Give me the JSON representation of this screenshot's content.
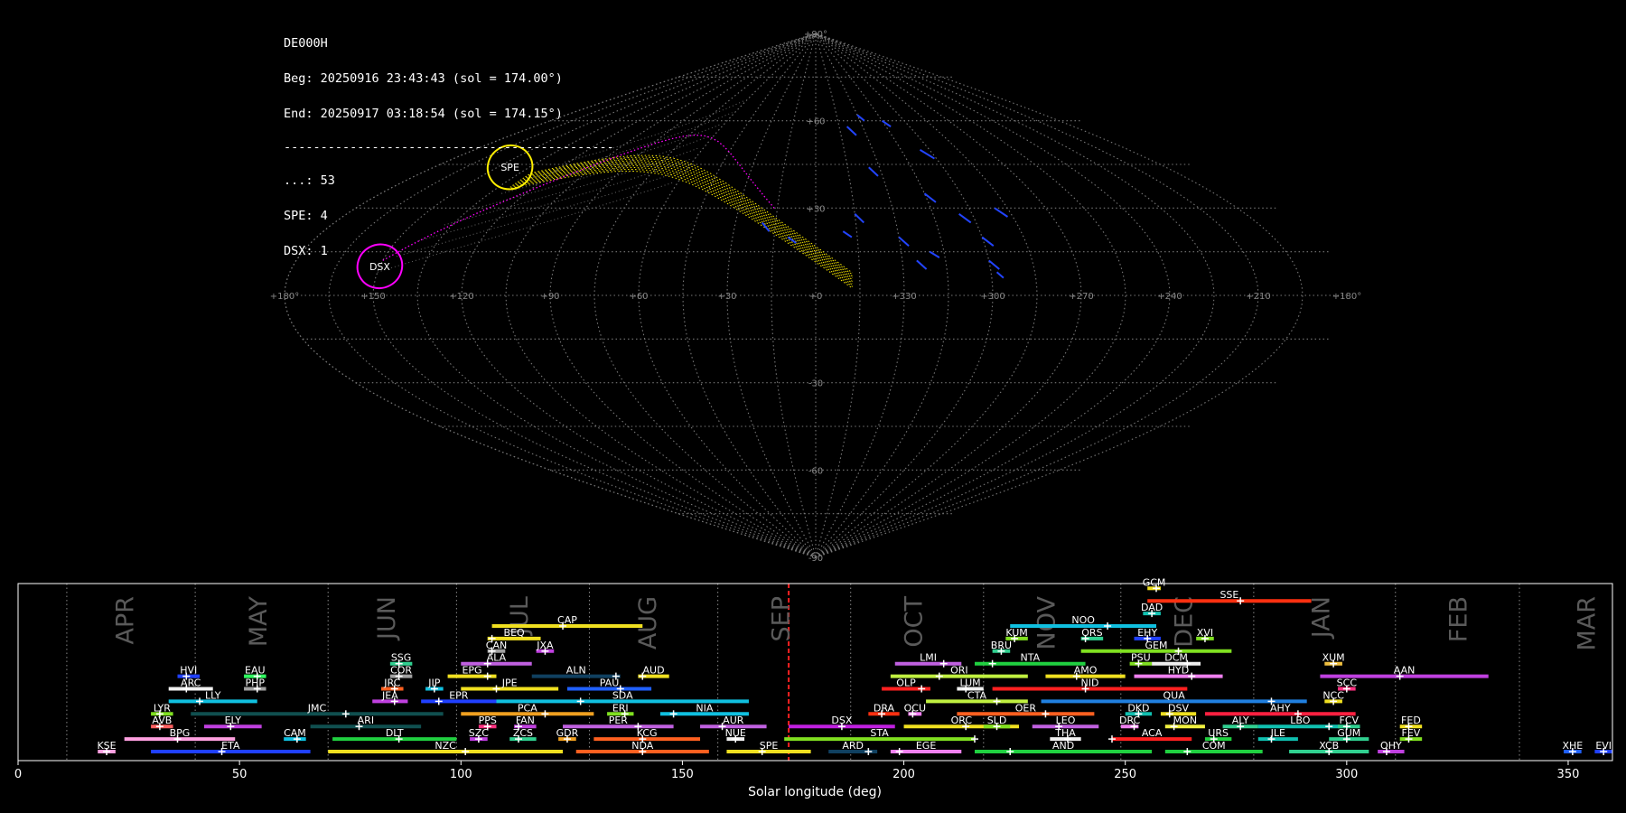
{
  "info": {
    "station": "DE000H",
    "beg": "Beg: 20250916 23:43:43 (sol = 174.00°)",
    "end": "End: 20250917 03:18:54 (sol = 174.15°)",
    "separator": "---------------------------------------------",
    "counts": [
      "...: 53",
      "SPE: 4",
      "DSX: 1"
    ]
  },
  "sky": {
    "lon_ticks": [
      "+180°",
      "+150",
      "+120",
      "+90",
      "+60",
      "+30",
      "+0",
      "+330",
      "+300",
      "+270",
      "+240",
      "+210",
      "+180°"
    ],
    "lat_ticks": [
      "+90°",
      "+60",
      "+30",
      "-30",
      "-60",
      "-90"
    ],
    "radiants": [
      {
        "name": "SPE",
        "lon": 144,
        "lat": 44
      },
      {
        "name": "DSX",
        "lon": 150,
        "lat": 10
      }
    ],
    "colors": {
      "grid": "#777777",
      "spe": "#ffee00",
      "dsx": "#ff00ff",
      "meteor": "#2244ff",
      "sporadic": "#ffffff"
    }
  },
  "chart_data": {
    "type": "timeline",
    "xlabel": "Solar longitude (deg)",
    "xlim": [
      0,
      360
    ],
    "xticks": [
      0,
      50,
      100,
      150,
      200,
      250,
      300,
      350
    ],
    "current_sol": 174,
    "month_boundaries": [
      11,
      40,
      70,
      99,
      129,
      158,
      188,
      218,
      249,
      279,
      311,
      339
    ],
    "months": [
      {
        "name": "APR",
        "x": 24
      },
      {
        "name": "MAY",
        "x": 54
      },
      {
        "name": "JUN",
        "x": 83
      },
      {
        "name": "JUL",
        "x": 113
      },
      {
        "name": "AUG",
        "x": 142
      },
      {
        "name": "SEP",
        "x": 172
      },
      {
        "name": "OCT",
        "x": 202
      },
      {
        "name": "NOV",
        "x": 232
      },
      {
        "name": "DEC",
        "x": 263
      },
      {
        "name": "JAN",
        "x": 294
      },
      {
        "name": "FEB",
        "x": 325
      },
      {
        "name": "MAR",
        "x": 354
      }
    ],
    "showers": [
      {
        "code": "GCM",
        "start": 255,
        "end": 258,
        "peak": 257,
        "row": 13,
        "color": "#f0e020"
      },
      {
        "code": "SSE",
        "start": 255,
        "end": 292,
        "peak": 276,
        "row": 12,
        "color": "#ff3010"
      },
      {
        "code": "CAP",
        "start": 107,
        "end": 141,
        "peak": 123,
        "row": 10,
        "color": "#f0e020"
      },
      {
        "code": "DAD",
        "start": 254,
        "end": 258,
        "peak": 256,
        "row": 11,
        "color": "#10c0b0"
      },
      {
        "code": "NOO",
        "start": 224,
        "end": 257,
        "peak": 246,
        "row": 10,
        "color": "#10c0e0"
      },
      {
        "code": "BEQ",
        "start": 106,
        "end": 118,
        "peak": 107,
        "row": 9,
        "color": "#f0e020"
      },
      {
        "code": "KUM",
        "start": 223,
        "end": 228,
        "peak": 225,
        "row": 9,
        "color": "#80e020"
      },
      {
        "code": "ORS",
        "start": 240,
        "end": 245,
        "peak": 241,
        "row": 9,
        "color": "#30d090"
      },
      {
        "code": "EHY",
        "start": 252,
        "end": 258,
        "peak": 255,
        "row": 9,
        "color": "#2040ff"
      },
      {
        "code": "XVI",
        "start": 266,
        "end": 270,
        "peak": 268,
        "row": 9,
        "color": "#80e020"
      },
      {
        "code": "CAN",
        "start": 106,
        "end": 110,
        "peak": 107,
        "row": 8,
        "color": "#a0a0a0"
      },
      {
        "code": "JXA",
        "start": 117,
        "end": 121,
        "peak": 119,
        "row": 8,
        "color": "#c040e0"
      },
      {
        "code": "BRU",
        "start": 220,
        "end": 224,
        "peak": 222,
        "row": 8,
        "color": "#30d090"
      },
      {
        "code": "GEM",
        "start": 240,
        "end": 274,
        "peak": 262,
        "row": 8,
        "color": "#80e020"
      },
      {
        "code": "SSG",
        "start": 84,
        "end": 89,
        "peak": 86,
        "row": 7,
        "color": "#30d090"
      },
      {
        "code": "ALA",
        "start": 100,
        "end": 116,
        "peak": 106,
        "row": 7,
        "color": "#c060e0"
      },
      {
        "code": "LMI",
        "start": 198,
        "end": 213,
        "peak": 209,
        "row": 7,
        "color": "#c060e0"
      },
      {
        "code": "NTA",
        "start": 216,
        "end": 241,
        "peak": 220,
        "row": 7,
        "color": "#20d040"
      },
      {
        "code": "PSU",
        "start": 251,
        "end": 256,
        "peak": 253,
        "row": 7,
        "color": "#80e020"
      },
      {
        "code": "DCM",
        "start": 256,
        "end": 267,
        "peak": 264,
        "row": 7,
        "color": "#f0f0f0"
      },
      {
        "code": "XUM",
        "start": 295,
        "end": 299,
        "peak": 297,
        "row": 7,
        "color": "#f0c040"
      },
      {
        "code": "HVI",
        "start": 36,
        "end": 41,
        "peak": 38,
        "row": 6,
        "color": "#2040ff"
      },
      {
        "code": "EAU",
        "start": 51,
        "end": 56,
        "peak": 54,
        "row": 6,
        "color": "#30ff60"
      },
      {
        "code": "COR",
        "start": 84,
        "end": 89,
        "peak": 86,
        "row": 6,
        "color": "#a0a0a0"
      },
      {
        "code": "EPG",
        "start": 97,
        "end": 108,
        "peak": 106,
        "row": 6,
        "color": "#f0e020"
      },
      {
        "code": "ALN",
        "start": 116,
        "end": 136,
        "peak": 135,
        "row": 6,
        "color": "#104060"
      },
      {
        "code": "AUD",
        "start": 140,
        "end": 147,
        "peak": 141,
        "row": 6,
        "color": "#f0e020"
      },
      {
        "code": "ORI",
        "start": 197,
        "end": 228,
        "peak": 208,
        "row": 6,
        "color": "#c0f040"
      },
      {
        "code": "AMO",
        "start": 232,
        "end": 250,
        "peak": 239,
        "row": 6,
        "color": "#f0e020"
      },
      {
        "code": "HYD",
        "start": 252,
        "end": 272,
        "peak": 265,
        "row": 6,
        "color": "#f080f0"
      },
      {
        "code": "AAN",
        "start": 294,
        "end": 332,
        "peak": 312,
        "row": 6,
        "color": "#c040e0"
      },
      {
        "code": "ARC",
        "start": 34,
        "end": 44,
        "peak": 38,
        "row": 5,
        "color": "#f0f0f0"
      },
      {
        "code": "PHP",
        "start": 51,
        "end": 56,
        "peak": 54,
        "row": 5,
        "color": "#a0a0a0"
      },
      {
        "code": "JRC",
        "start": 82,
        "end": 87,
        "peak": 85,
        "row": 5,
        "color": "#ff6020"
      },
      {
        "code": "JIP",
        "start": 92,
        "end": 96,
        "peak": 94,
        "row": 5,
        "color": "#10c0e0"
      },
      {
        "code": "JPE",
        "start": 100,
        "end": 122,
        "peak": 108,
        "row": 5,
        "color": "#f0e020"
      },
      {
        "code": "PAU",
        "start": 124,
        "end": 143,
        "peak": 136,
        "row": 5,
        "color": "#2060ff"
      },
      {
        "code": "OLP",
        "start": 195,
        "end": 206,
        "peak": 204,
        "row": 5,
        "color": "#ff2020"
      },
      {
        "code": "LUM",
        "start": 212,
        "end": 218,
        "peak": 214,
        "row": 5,
        "color": "#f0f0f0"
      },
      {
        "code": "NID",
        "start": 220,
        "end": 264,
        "peak": 241,
        "row": 5,
        "color": "#ff2020"
      },
      {
        "code": "SCC",
        "start": 298,
        "end": 302,
        "peak": 300,
        "row": 5,
        "color": "#ff3080"
      },
      {
        "code": "LLY",
        "start": 34,
        "end": 54,
        "peak": 41,
        "row": 4,
        "color": "#10c0e0"
      },
      {
        "code": "JEA",
        "start": 80,
        "end": 88,
        "peak": 85,
        "row": 4,
        "color": "#c040e0"
      },
      {
        "code": "EPR",
        "start": 91,
        "end": 108,
        "peak": 95,
        "row": 4,
        "color": "#2040ff"
      },
      {
        "code": "SDA",
        "start": 108,
        "end": 165,
        "peak": 127,
        "row": 4,
        "color": "#10c0e0"
      },
      {
        "code": "CTA",
        "start": 205,
        "end": 228,
        "peak": 221,
        "row": 4,
        "color": "#c0f040"
      },
      {
        "code": "QUA",
        "start": 231,
        "end": 291,
        "peak": 283,
        "row": 4,
        "color": "#2080e0"
      },
      {
        "code": "NCC",
        "start": 295,
        "end": 299,
        "peak": 297,
        "row": 4,
        "color": "#f0e020"
      },
      {
        "code": "LYR",
        "start": 30,
        "end": 35,
        "peak": 32,
        "row": 3,
        "color": "#80e020"
      },
      {
        "code": "JMC",
        "start": 39,
        "end": 96,
        "peak": 74,
        "row": 3,
        "color": "#105050"
      },
      {
        "code": "PCA",
        "start": 100,
        "end": 130,
        "peak": 119,
        "row": 3,
        "color": "#f0a020"
      },
      {
        "code": "ERI",
        "start": 133,
        "end": 139,
        "peak": 137,
        "row": 3,
        "color": "#80e020"
      },
      {
        "code": "NIA",
        "start": 145,
        "end": 165,
        "peak": 148,
        "row": 3,
        "color": "#10c0e0"
      },
      {
        "code": "DRA",
        "start": 192,
        "end": 199,
        "peak": 195,
        "row": 3,
        "color": "#ff3010"
      },
      {
        "code": "OCU",
        "start": 201,
        "end": 204,
        "peak": 202,
        "row": 3,
        "color": "#ff80ff"
      },
      {
        "code": "OER",
        "start": 212,
        "end": 243,
        "peak": 232,
        "row": 3,
        "color": "#ff6020"
      },
      {
        "code": "DKD",
        "start": 250,
        "end": 256,
        "peak": 253,
        "row": 3,
        "color": "#10c0b0"
      },
      {
        "code": "DSV",
        "start": 258,
        "end": 266,
        "peak": 260,
        "row": 3,
        "color": "#f0e020"
      },
      {
        "code": "AHY",
        "start": 268,
        "end": 302,
        "peak": 289,
        "row": 3,
        "color": "#ff2040"
      },
      {
        "code": "AVB",
        "start": 30,
        "end": 35,
        "peak": 32,
        "row": 2,
        "color": "#ff6060"
      },
      {
        "code": "ELY",
        "start": 42,
        "end": 55,
        "peak": 48,
        "row": 2,
        "color": "#c040e0"
      },
      {
        "code": "ARI",
        "start": 66,
        "end": 91,
        "peak": 77,
        "row": 2,
        "color": "#105050"
      },
      {
        "code": "PPS",
        "start": 104,
        "end": 108,
        "peak": 106,
        "row": 2,
        "color": "#ff3080"
      },
      {
        "code": "FAN",
        "start": 112,
        "end": 117,
        "peak": 113,
        "row": 2,
        "color": "#c040e0"
      },
      {
        "code": "PER",
        "start": 123,
        "end": 148,
        "peak": 140,
        "row": 2,
        "color": "#c060e0"
      },
      {
        "code": "AUR",
        "start": 154,
        "end": 169,
        "peak": 159,
        "row": 2,
        "color": "#c060e0"
      },
      {
        "code": "DSX",
        "start": 174,
        "end": 198,
        "peak": 186,
        "row": 2,
        "color": "#c020e0"
      },
      {
        "code": "ORC",
        "start": 200,
        "end": 226,
        "peak": 214,
        "row": 2,
        "color": "#f0e020"
      },
      {
        "code": "SLD",
        "start": 218,
        "end": 224,
        "peak": 221,
        "row": 2,
        "color": "#80e020"
      },
      {
        "code": "LEO",
        "start": 229,
        "end": 244,
        "peak": 235,
        "row": 2,
        "color": "#c060e0"
      },
      {
        "code": "DRC",
        "start": 249,
        "end": 253,
        "peak": 252,
        "row": 2,
        "color": "#f080f0"
      },
      {
        "code": "MON",
        "start": 259,
        "end": 268,
        "peak": 261,
        "row": 2,
        "color": "#f0f040"
      },
      {
        "code": "ALY",
        "start": 272,
        "end": 280,
        "peak": 276,
        "row": 2,
        "color": "#30d090"
      },
      {
        "code": "LBO",
        "start": 280,
        "end": 299,
        "peak": 296,
        "row": 2,
        "color": "#10c0b0"
      },
      {
        "code": "FCV",
        "start": 298,
        "end": 303,
        "peak": 300,
        "row": 2,
        "color": "#30d090"
      },
      {
        "code": "FED",
        "start": 312,
        "end": 317,
        "peak": 314,
        "row": 2,
        "color": "#f0e020"
      },
      {
        "code": "BPG",
        "start": 24,
        "end": 49,
        "peak": 36,
        "row": 1,
        "color": "#ffa0e0"
      },
      {
        "code": "CAM",
        "start": 60,
        "end": 65,
        "peak": 63,
        "row": 1,
        "color": "#10c0e0"
      },
      {
        "code": "DLT",
        "start": 71,
        "end": 99,
        "peak": 86,
        "row": 1,
        "color": "#20d040"
      },
      {
        "code": "SZC",
        "start": 102,
        "end": 106,
        "peak": 104,
        "row": 1,
        "color": "#c040e0"
      },
      {
        "code": "ZCS",
        "start": 111,
        "end": 117,
        "peak": 113,
        "row": 1,
        "color": "#30d090"
      },
      {
        "code": "GDR",
        "start": 122,
        "end": 126,
        "peak": 124,
        "row": 1,
        "color": "#f0a020"
      },
      {
        "code": "KCG",
        "start": 130,
        "end": 154,
        "peak": 141,
        "row": 1,
        "color": "#ff6020"
      },
      {
        "code": "NUE",
        "start": 160,
        "end": 164,
        "peak": 162,
        "row": 1,
        "color": "#f0f0f0"
      },
      {
        "code": "STA",
        "start": 173,
        "end": 216,
        "peak": 216,
        "row": 1,
        "color": "#80e020"
      },
      {
        "code": "THA",
        "start": 233,
        "end": 240,
        "peak": 237,
        "row": 1,
        "color": "#f0f0f0"
      },
      {
        "code": "ACA",
        "start": 247,
        "end": 265,
        "peak": 247,
        "row": 1,
        "color": "#ff2020"
      },
      {
        "code": "URS",
        "start": 268,
        "end": 274,
        "peak": 270,
        "row": 1,
        "color": "#20d040"
      },
      {
        "code": "JLE",
        "start": 280,
        "end": 289,
        "peak": 283,
        "row": 1,
        "color": "#10c0b0"
      },
      {
        "code": "GUM",
        "start": 296,
        "end": 305,
        "peak": 300,
        "row": 1,
        "color": "#30d090"
      },
      {
        "code": "FEV",
        "start": 312,
        "end": 317,
        "peak": 314,
        "row": 1,
        "color": "#80e020"
      },
      {
        "code": "KSE",
        "start": 18,
        "end": 22,
        "peak": 20,
        "row": 0,
        "color": "#ffa0e0"
      },
      {
        "code": "ETA",
        "start": 30,
        "end": 66,
        "peak": 46,
        "row": 0,
        "color": "#2040ff"
      },
      {
        "code": "NZC",
        "start": 70,
        "end": 123,
        "peak": 101,
        "row": 0,
        "color": "#f0e020"
      },
      {
        "code": "NDA",
        "start": 126,
        "end": 156,
        "peak": 141,
        "row": 0,
        "color": "#ff6020"
      },
      {
        "code": "SPE",
        "start": 160,
        "end": 179,
        "peak": 168,
        "row": 0,
        "color": "#f0e020"
      },
      {
        "code": "ARD",
        "start": 183,
        "end": 194,
        "peak": 192,
        "row": 0,
        "color": "#104060"
      },
      {
        "code": "EGE",
        "start": 197,
        "end": 213,
        "peak": 199,
        "row": 0,
        "color": "#f080f0"
      },
      {
        "code": "AND",
        "start": 216,
        "end": 256,
        "peak": 224,
        "row": 0,
        "color": "#20d040"
      },
      {
        "code": "COM",
        "start": 259,
        "end": 281,
        "peak": 264,
        "row": 0,
        "color": "#20d040"
      },
      {
        "code": "XCB",
        "start": 287,
        "end": 305,
        "peak": 296,
        "row": 0,
        "color": "#30d090"
      },
      {
        "code": "OHY",
        "start": 307,
        "end": 313,
        "peak": 309,
        "row": 0,
        "color": "#c040e0"
      },
      {
        "code": "XHE",
        "start": 349,
        "end": 353,
        "peak": 351,
        "row": 0,
        "color": "#2060ff"
      },
      {
        "code": "EVI",
        "start": 356,
        "end": 360,
        "peak": 358,
        "row": 0,
        "color": "#2040ff"
      }
    ]
  }
}
